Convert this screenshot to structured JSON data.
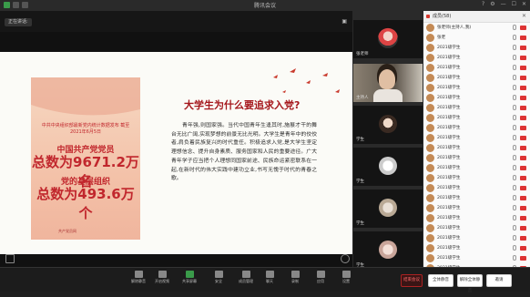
{
  "window": {
    "title": "腾讯会议",
    "right_controls": [
      "?",
      "⚙",
      "—",
      "☐",
      "✕"
    ]
  },
  "stage": {
    "speaker_label": "正在讲话:",
    "slide": {
      "headline": "大学生为什么要追求入党?",
      "body": "青年强,则国家强。当代中国青年生逢其时,施展才干的舞台无比广阔,实现梦想的前景无比光明。大学生是青年中的佼佼者,肩负着民族复兴的时代重任。积极追求入党,是大学生坚定理想信念、提升自身素质、服务国家和人民的重要途径。广大青年学子应当把个人理想同国家前途、民族命运紧密联系在一起,在新时代的伟大实践中建功立业,书写无愧于时代的青春之歌。",
      "poster": {
        "title": "中共中央组织部最新党内统计数据发布 截至2021年6月5日",
        "line1": "中国共产党党员",
        "line2": "总数为9671.2万名",
        "line3": "党的基层组织",
        "line4": "总数为493.6万个",
        "footer": "共产党员网"
      }
    }
  },
  "video_tiles": [
    {
      "name": "张老师",
      "kind": "avatar"
    },
    {
      "name": "主持人",
      "kind": "camera"
    },
    {
      "name": "学生",
      "kind": "avatar"
    },
    {
      "name": "学生",
      "kind": "avatar"
    },
    {
      "name": "学生",
      "kind": "avatar"
    },
    {
      "name": "学生",
      "kind": "avatar"
    }
  ],
  "chat": {
    "header": "成员(58)",
    "close": "✕",
    "members": [
      "张老师(主持人,我)",
      "张老",
      "2021级学生",
      "2021级学生",
      "2021级学生",
      "2021级学生",
      "2021级学生",
      "2021级学生",
      "2021级学生",
      "2021级学生",
      "2021级学生",
      "2021级学生",
      "2021级学生",
      "2021级学生",
      "2021级学生",
      "2021级学生",
      "2021级学生",
      "2021级学生",
      "2021级学生",
      "2021级学生",
      "2021级学生",
      "2021级学生",
      "2021级学生",
      "2021级学生",
      "2021级学生"
    ],
    "buttons": [
      "全体静音",
      "解除全体静音",
      "邀请"
    ]
  },
  "toolbar": {
    "buttons": [
      {
        "label": "解除静音",
        "color": "#888"
      },
      {
        "label": "开启视频",
        "color": "#888"
      },
      {
        "label": "共享屏幕",
        "color": "#3a9b4a"
      },
      {
        "label": "安全",
        "color": "#888"
      },
      {
        "label": "成员管理",
        "color": "#888"
      },
      {
        "label": "聊天",
        "color": "#888"
      },
      {
        "label": "录制",
        "color": "#888"
      },
      {
        "label": "应用",
        "color": "#888"
      },
      {
        "label": "设置",
        "color": "#888"
      }
    ],
    "leave": "结束会议"
  }
}
